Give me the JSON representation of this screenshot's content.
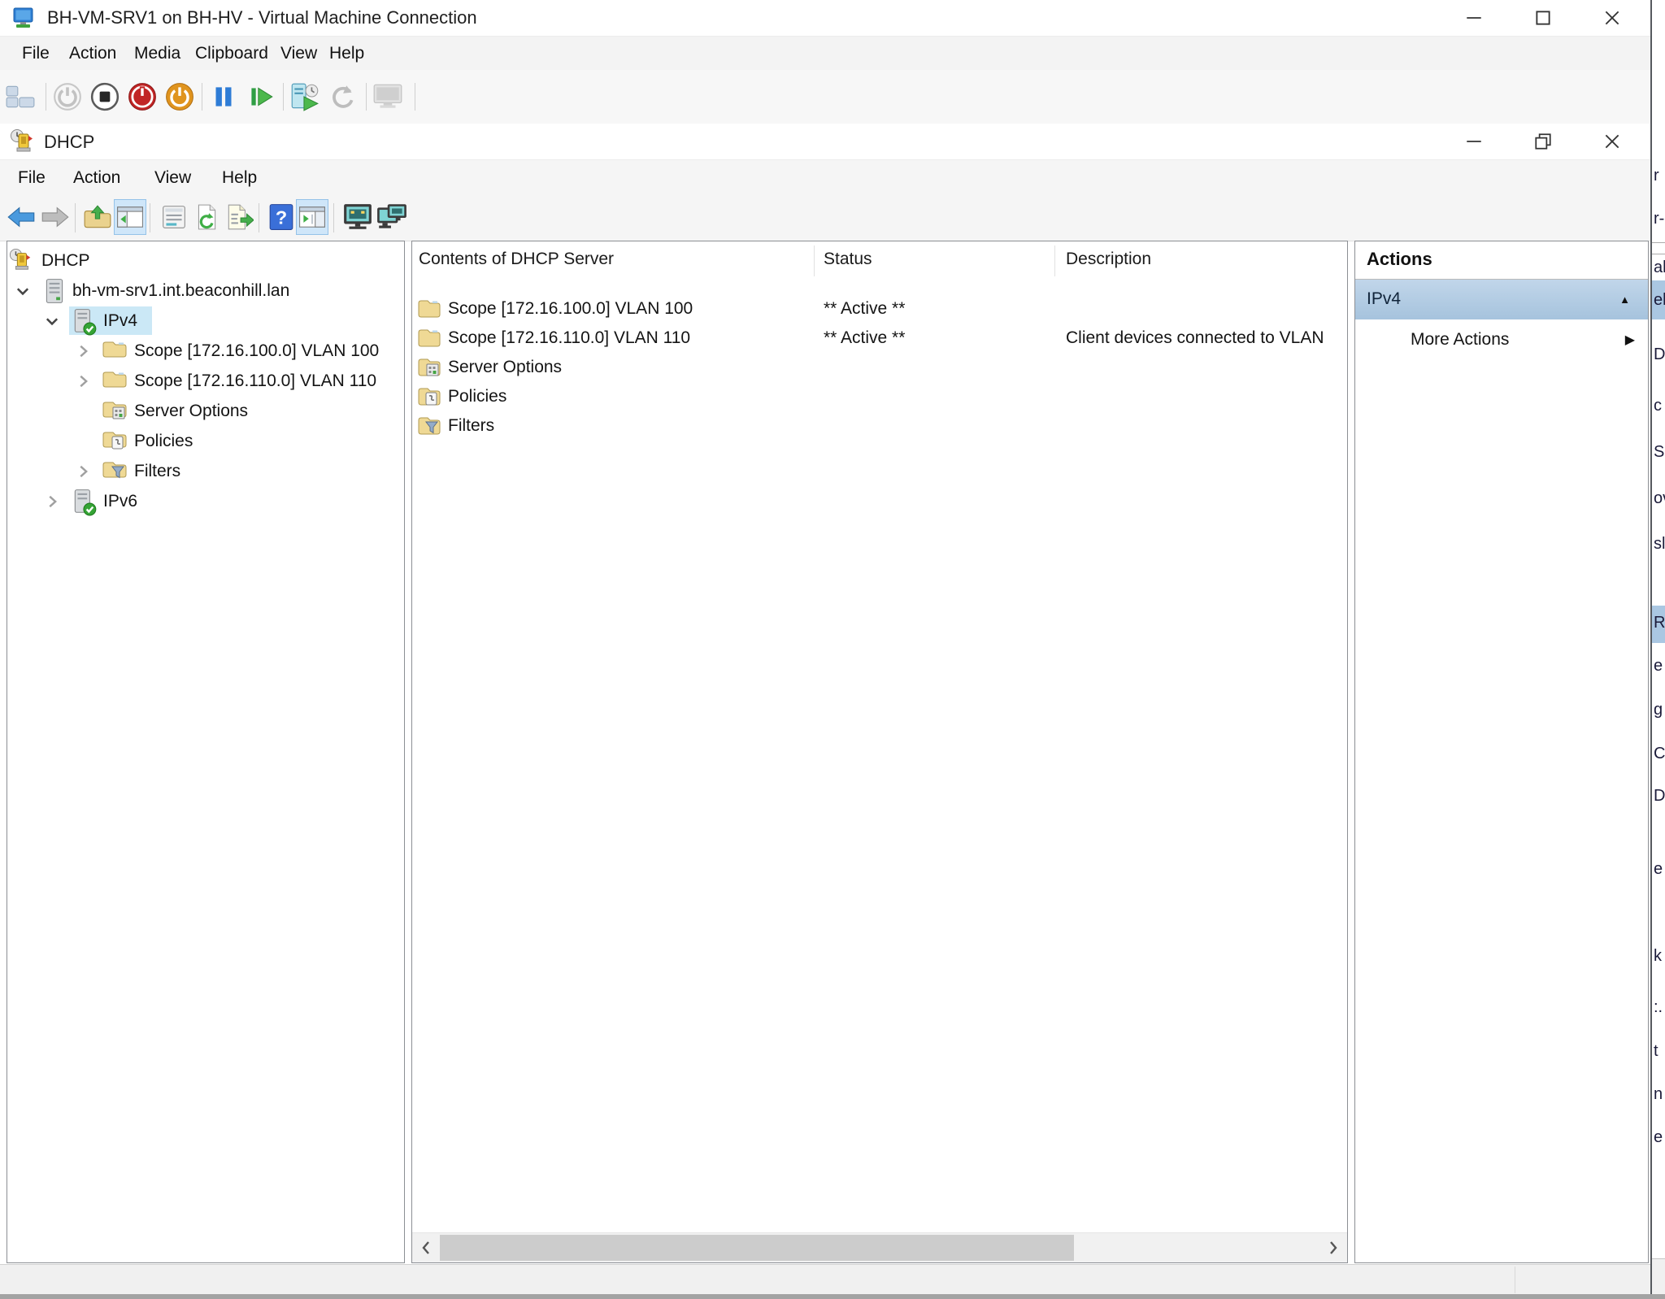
{
  "vm_window": {
    "title": "BH-VM-SRV1 on BH-HV - Virtual Machine Connection",
    "menu": [
      {
        "label": "File"
      },
      {
        "label": "Action"
      },
      {
        "label": "Media"
      },
      {
        "label": "Clipboard"
      },
      {
        "label": "View"
      },
      {
        "label": "Help"
      }
    ],
    "toolbar_icons": [
      "ctrl-alt-del-icon",
      "start-icon",
      "turn-off-icon",
      "shut-down-icon",
      "save-icon",
      "pause-icon",
      "reset-icon",
      "checkpoint-icon",
      "revert-icon",
      "enhanced-session-icon"
    ]
  },
  "dhcp_window": {
    "title": "DHCP",
    "menu": [
      {
        "label": "File"
      },
      {
        "label": "Action"
      },
      {
        "label": "View"
      },
      {
        "label": "Help"
      }
    ],
    "toolbar_icons": [
      "back-icon",
      "forward-icon",
      "up-one-level-icon",
      "show-console-tree-icon",
      "properties-icon",
      "refresh-icon",
      "export-list-icon",
      "help-icon",
      "show-action-pane-icon",
      "remote-desktop-icon",
      "remote-desktops-icon"
    ]
  },
  "tree": {
    "items": [
      {
        "label": "DHCP"
      },
      {
        "label": "bh-vm-srv1.int.beaconhill.lan",
        "state": "expanded"
      },
      {
        "label": "IPv4",
        "state": "expanded",
        "selected": true
      },
      {
        "label": "Scope [172.16.100.0] VLAN 100",
        "state": "collapsed"
      },
      {
        "label": "Scope [172.16.110.0] VLAN 110",
        "state": "collapsed"
      },
      {
        "label": "Server Options"
      },
      {
        "label": "Policies"
      },
      {
        "label": "Filters",
        "state": "collapsed"
      },
      {
        "label": "IPv6",
        "state": "collapsed"
      }
    ]
  },
  "list": {
    "columns": [
      {
        "label": "Contents of DHCP Server"
      },
      {
        "label": "Status"
      },
      {
        "label": "Description"
      }
    ],
    "rows": [
      {
        "name": "Scope [172.16.100.0] VLAN 100",
        "status": "** Active **",
        "description": ""
      },
      {
        "name": "Scope [172.16.110.0] VLAN 110",
        "status": "** Active **",
        "description": "Client devices connected to VLAN"
      },
      {
        "name": "Server Options",
        "status": "",
        "description": ""
      },
      {
        "name": "Policies",
        "status": "",
        "description": ""
      },
      {
        "name": "Filters",
        "status": "",
        "description": ""
      }
    ]
  },
  "actions_pane": {
    "header": "Actions",
    "group": "IPv4",
    "more_actions": "More Actions"
  },
  "edge_window_fragments": [
    {
      "text": "r"
    },
    {
      "text": "r-"
    },
    {
      "text": "al"
    },
    {
      "text": "el"
    },
    {
      "text": "Di"
    },
    {
      "text": "c"
    },
    {
      "text": "S"
    },
    {
      "text": "ov"
    },
    {
      "text": "sl"
    },
    {
      "text": "R"
    },
    {
      "text": "e"
    },
    {
      "text": "g"
    },
    {
      "text": "C"
    },
    {
      "text": "D"
    },
    {
      "text": "e"
    },
    {
      "text": "k"
    },
    {
      "text": ":."
    },
    {
      "text": "t"
    },
    {
      "text": "n"
    },
    {
      "text": "e"
    }
  ],
  "colors": {
    "tree_selection": "#cbe8f6",
    "actions_group_selected": "#a6c3dd",
    "toolbar_toggle": "#cfe6f9"
  }
}
